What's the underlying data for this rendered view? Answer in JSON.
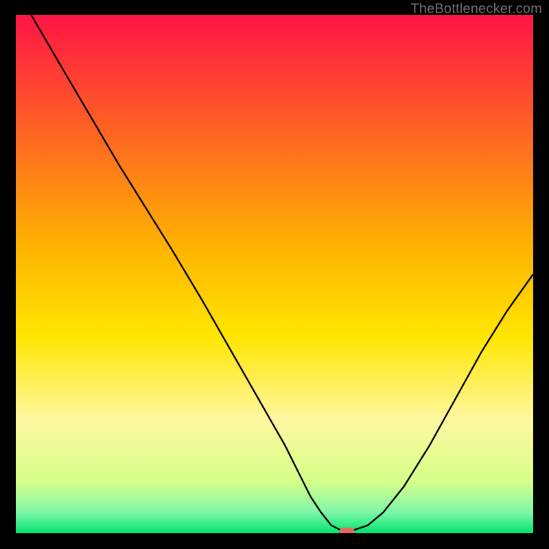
{
  "chart_data": {
    "type": "line",
    "title": "",
    "xlabel": "",
    "ylabel": "",
    "xlim": [
      0,
      100
    ],
    "ylim": [
      0,
      100
    ],
    "x": [
      3,
      10,
      20,
      30,
      36,
      40,
      44,
      48,
      52,
      55,
      57,
      59,
      61,
      63,
      65,
      68,
      71,
      75,
      80,
      85,
      90,
      95,
      100
    ],
    "values": [
      100,
      88,
      71,
      55,
      45,
      38,
      31,
      24,
      17,
      11,
      7,
      4,
      1.5,
      0.5,
      0.5,
      1.5,
      4,
      9,
      17,
      26,
      35,
      43,
      50
    ],
    "optimum_marker": {
      "x": 64,
      "y": 0.3
    },
    "gradient_bands": [
      {
        "stop": 0.0,
        "color": "#ff1445"
      },
      {
        "stop": 0.45,
        "color": "#ffb400"
      },
      {
        "stop": 0.62,
        "color": "#ffe600"
      },
      {
        "stop": 0.78,
        "color": "#fff7a0"
      },
      {
        "stop": 0.9,
        "color": "#d6ff8a"
      },
      {
        "stop": 0.96,
        "color": "#7ef7a8"
      },
      {
        "stop": 1.0,
        "color": "#00e46f"
      }
    ]
  },
  "watermark": "TheBottleneсker.com"
}
